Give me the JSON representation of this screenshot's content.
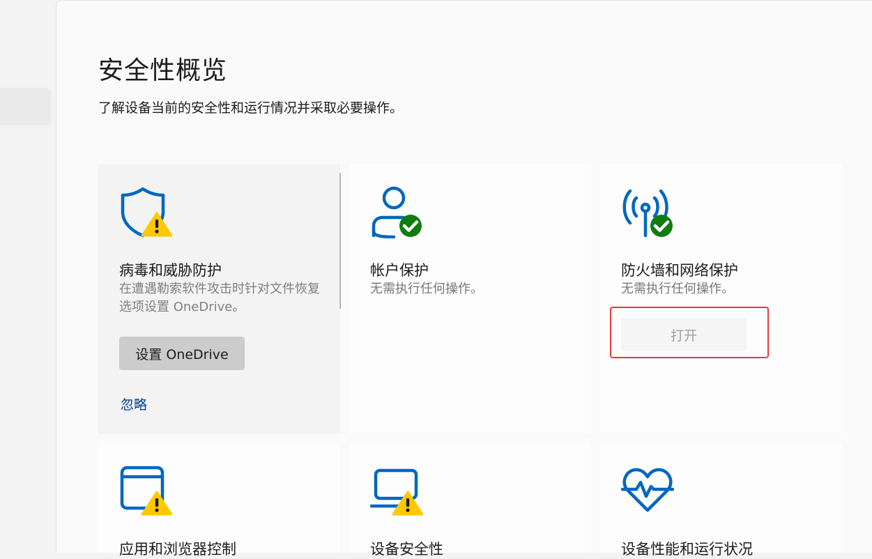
{
  "page": {
    "title": "安全性概览",
    "subtitle": "了解设备当前的安全性和运行情况并采取必要操作。"
  },
  "cards": [
    {
      "title": "病毒和威胁防护",
      "description": "在遭遇勒索软件攻击时针对文件恢复选项设置 OneDrive。",
      "primary_button": "设置 OneDrive",
      "link": "忽略",
      "icon": "shield-warning-icon",
      "status": "warning"
    },
    {
      "title": "帐户保护",
      "description": "无需执行任何操作。",
      "icon": "person-check-icon",
      "status": "ok"
    },
    {
      "title": "防火墙和网络保护",
      "description": "无需执行任何操作。",
      "button": "打开",
      "icon": "wireless-check-icon",
      "status": "ok"
    },
    {
      "title": "应用和浏览器控制",
      "icon": "app-window-warning-icon",
      "status": "warning"
    },
    {
      "title": "设备安全性",
      "icon": "laptop-warning-icon",
      "status": "warning"
    },
    {
      "title": "设备性能和运行状况",
      "icon": "heart-pulse-icon",
      "status": "ok"
    }
  ],
  "colors": {
    "accent": "#0067c0",
    "ok": "#107c10",
    "warning": "#ffc800",
    "highlight": "#e53935",
    "link": "#003e92"
  }
}
